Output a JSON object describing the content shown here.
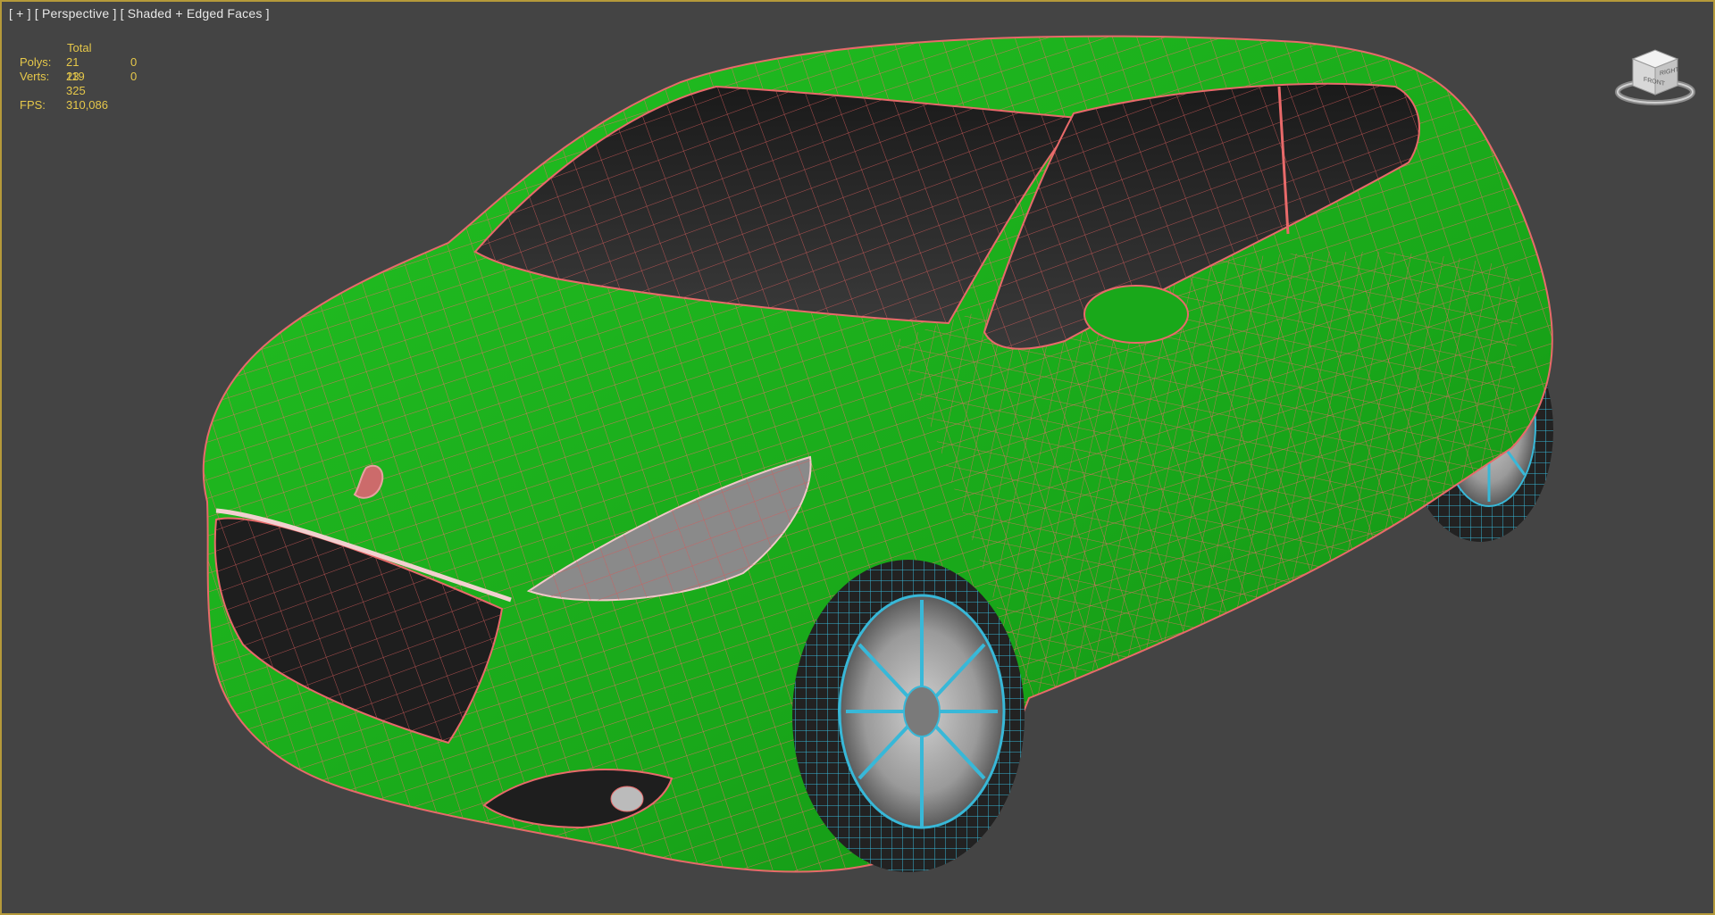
{
  "viewport": {
    "menu_label": "[ + ]",
    "view_label": "[ Perspective ]",
    "shading_label": "[ Shaded + Edged Faces ]",
    "border_color": "#b59a3a",
    "background_color": "#444444"
  },
  "statistics": {
    "header": "Total",
    "polys_label": "Polys:",
    "polys_total": "21 119",
    "polys_selected": "0",
    "verts_label": "Verts:",
    "verts_total": "23 325",
    "verts_selected": "0",
    "fps_label": "FPS:",
    "fps_value": "310,086",
    "text_color": "#e6c84a"
  },
  "viewcube": {
    "front_label": "FRONT",
    "right_label": "RIGHT"
  },
  "model": {
    "body_color": "#19a81a",
    "edge_color": "#e86a6a",
    "wheel_edge_color": "#38b8d8",
    "glass_color": "#111111"
  }
}
